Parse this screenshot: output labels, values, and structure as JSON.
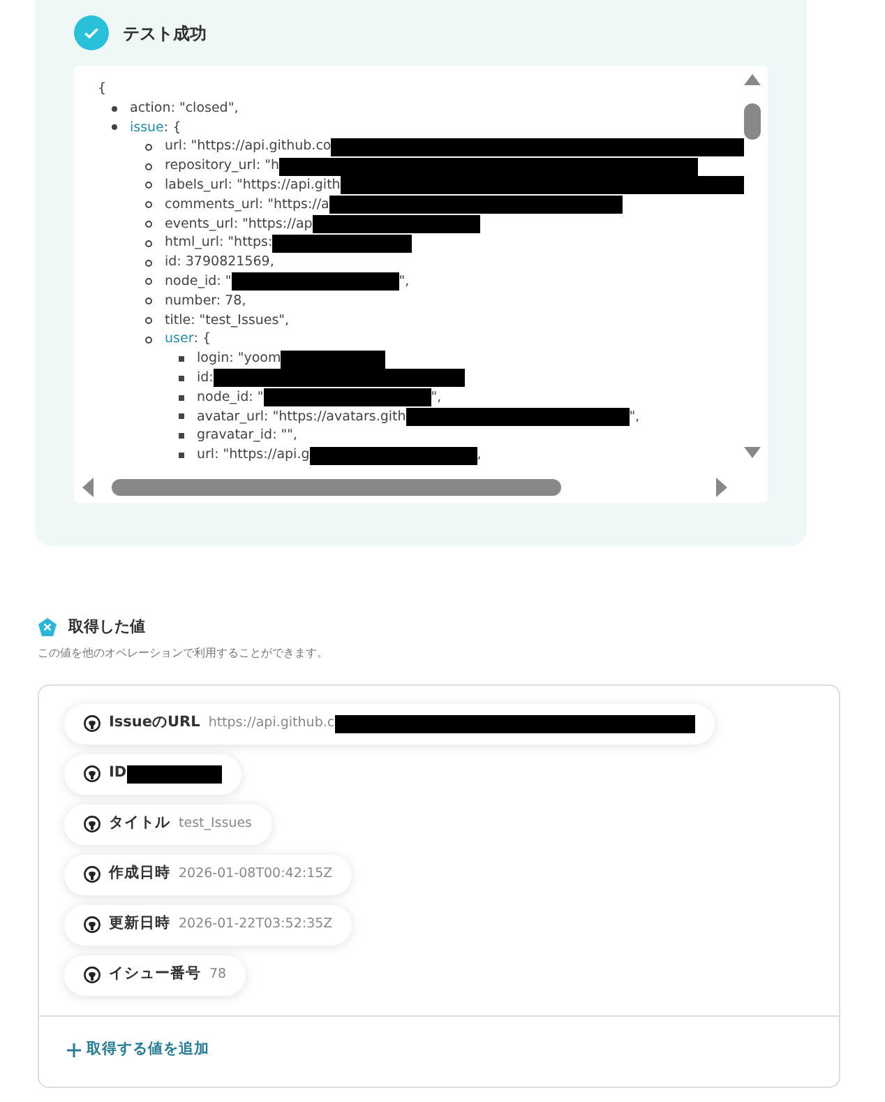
{
  "test_result": {
    "title": "テスト成功",
    "success": true
  },
  "json_view": {
    "open": "{",
    "items": [
      {
        "text": "action: \"closed\","
      },
      {
        "key": "issue",
        "text": ": {",
        "children": [
          {
            "text": "url: \"https://api.github.co",
            "redacted": true
          },
          {
            "text": "repository_url: \"h",
            "redacted": true
          },
          {
            "text": "labels_url: \"https://api.gith",
            "redacted": true
          },
          {
            "text": "comments_url: \"https://a",
            "redacted": true
          },
          {
            "text": "events_url: \"https://ap",
            "redacted": true
          },
          {
            "text": "html_url: \"https:",
            "redacted": true
          },
          {
            "text": "id: 3790821569,"
          },
          {
            "text": "node_id: \"",
            "redacted": true,
            "after": "\","
          },
          {
            "text": "number: 78,"
          },
          {
            "text": "title: \"test_Issues\","
          },
          {
            "key": "user",
            "text": ": {",
            "children": [
              {
                "text": "login: \"yoom",
                "redacted": true
              },
              {
                "text": "id:",
                "redacted": true
              },
              {
                "text": "node_id: \"",
                "redacted": true,
                "after": "\","
              },
              {
                "text": "avatar_url: \"https://avatars.gith",
                "redacted": true,
                "after": "\","
              },
              {
                "text": "gravatar_id: \"\","
              },
              {
                "text": "url: \"https://api.g",
                "redacted": true,
                "after": ","
              }
            ]
          }
        ]
      }
    ]
  },
  "values_section": {
    "title": "取得した値",
    "description": "この値を他のオペレーションで利用することができます。",
    "values": [
      {
        "label": "IssueのURL",
        "value": "https://api.github.c",
        "redacted": true
      },
      {
        "label": "ID",
        "redacted": true
      },
      {
        "label": "タイトル",
        "value": "test_Issues"
      },
      {
        "label": "作成日時",
        "value": "2026-01-08T00:42:15Z"
      },
      {
        "label": "更新日時",
        "value": "2026-01-22T03:52:35Z"
      },
      {
        "label": "イシュー番号",
        "value": "78"
      }
    ],
    "add_link": "取得する値を追加"
  }
}
